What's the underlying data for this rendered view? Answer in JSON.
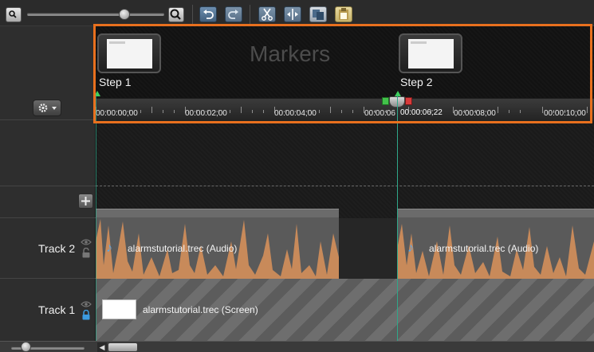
{
  "markers": {
    "title": "Markers",
    "items": [
      {
        "label": "Step 1"
      },
      {
        "label": "Step 2"
      }
    ]
  },
  "ruler": {
    "labels": [
      "00:00:00;00",
      "00:00:02;00",
      "00:00:04;00",
      "00:00:06",
      "00:00:08;00",
      "00:00:10;00"
    ],
    "playhead_time": "00:00:06;22"
  },
  "tracks": {
    "track2": {
      "name": "Track 2",
      "clips": [
        {
          "label": "alarmstutorial.trec (Audio)"
        },
        {
          "label": "alarmstutorial.trec (Audio)"
        }
      ]
    },
    "track1": {
      "name": "Track 1",
      "clip_label": "alarmstutorial.trec (Screen)"
    }
  },
  "colors": {
    "highlight": "#e8701e",
    "playhead": "#2fa88a",
    "waveform": "#c88a5a"
  }
}
